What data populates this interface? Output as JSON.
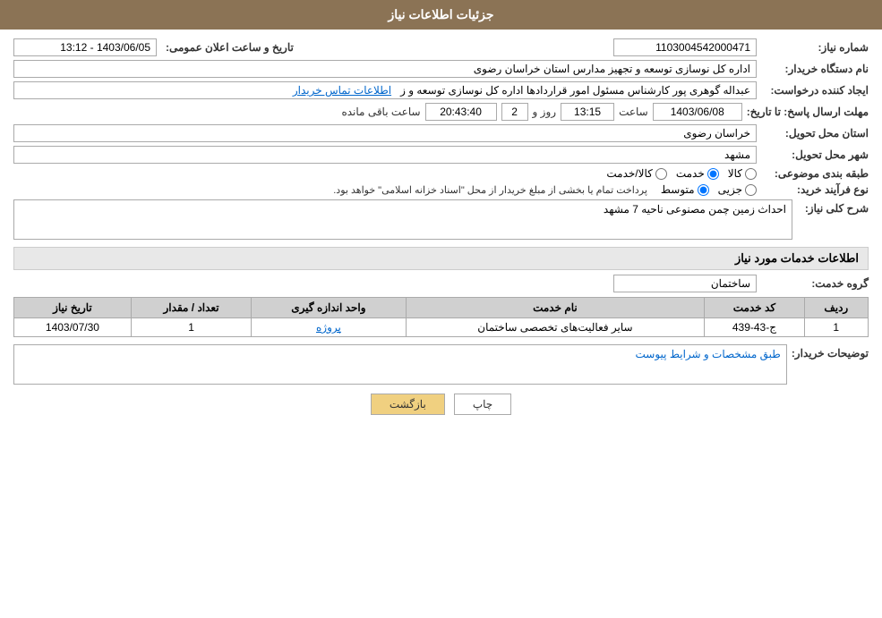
{
  "header": {
    "title": "جزئیات اطلاعات نیاز"
  },
  "fields": {
    "need_number_label": "شماره نیاز:",
    "need_number_value": "1103004542000471",
    "buyer_label": "نام دستگاه خریدار:",
    "buyer_value": "اداره کل نوسازی  توسعه و تجهیز مدارس استان خراسان رضوی",
    "requester_label": "ایجاد کننده درخواست:",
    "requester_value": "عبداله گوهری پور کارشناس مسئول امور قراردادها  اداره کل نوسازی  توسعه و ز",
    "requester_link": "اطلاعات تماس خریدار",
    "deadline_label": "مهلت ارسال پاسخ: تا تاریخ:",
    "announce_date_label": "تاریخ و ساعت اعلان عمومی:",
    "announce_date_value": "1403/06/05 - 13:12",
    "deadline_date_value": "1403/06/08",
    "deadline_time_label": "ساعت",
    "deadline_time_value": "13:15",
    "remaining_day_label": "روز و",
    "remaining_day_value": "2",
    "remaining_time_label": "ساعت باقی مانده",
    "remaining_time_value": "20:43:40",
    "province_label": "استان محل تحویل:",
    "province_value": "خراسان رضوی",
    "city_label": "شهر محل تحویل:",
    "city_value": "مشهد",
    "category_label": "طبقه بندی موضوعی:",
    "category_options": [
      "کالا",
      "خدمت",
      "کالا/خدمت"
    ],
    "category_selected": "خدمت",
    "purchase_type_label": "نوع فرآیند خرید:",
    "purchase_type_options": [
      "جزیی",
      "متوسط"
    ],
    "purchase_type_selected": "متوسط",
    "purchase_type_note": "پرداخت تمام یا بخشی از مبلغ خریدار از محل \"اسناد خزانه اسلامی\" خواهد بود.",
    "description_label": "شرح کلی نیاز:",
    "description_value": "احداث زمین چمن مصنوعی ناحیه 7 مشهد",
    "services_section_title": "اطلاعات خدمات مورد نیاز",
    "service_group_label": "گروه خدمت:",
    "service_group_value": "ساختمان",
    "table": {
      "columns": [
        "ردیف",
        "کد خدمت",
        "نام خدمت",
        "واحد اندازه گیری",
        "تعداد / مقدار",
        "تاریخ نیاز"
      ],
      "rows": [
        {
          "row": "1",
          "code": "ج-43-439",
          "name": "سایر فعالیت‌های تخصصی ساختمان",
          "unit": "پروژه",
          "quantity": "1",
          "date": "1403/07/30"
        }
      ]
    },
    "buyer_desc_label": "توضیحات خریدار:",
    "buyer_desc_value": "طبق مشخصات و شرایط پیوست"
  },
  "buttons": {
    "print_label": "چاپ",
    "back_label": "بازگشت"
  }
}
